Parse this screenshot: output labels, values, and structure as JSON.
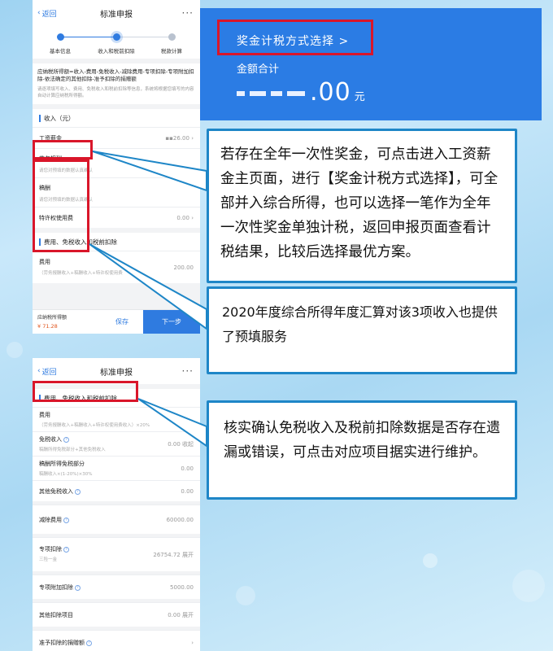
{
  "phone_top": {
    "nav": {
      "back": "返回",
      "title": "标准申报",
      "more": "···"
    },
    "steps": [
      "基本信息",
      "收入和税前扣除",
      "税款计算"
    ],
    "formula": "应纳税所得额=收入-费用-免税收入-减除费用-专项扣除-专项附加扣除-依法确定的其他扣除-准予扣除的捐赠额",
    "formula_desc": "请逐项填写收入、费用、免税收入和税前扣除等信息，系统将根据您填写的内容自动计算应纳税所得额。",
    "income_section": "收入（元）",
    "rows": [
      {
        "label": "工资薪金",
        "value": "26.00"
      },
      {
        "label": "劳务报酬",
        "sub": "请您对预填的数据认真确认"
      },
      {
        "label": "稿酬",
        "sub": "请您对预填的数据认真确认"
      },
      {
        "label": "特许权使用费",
        "value": "0.00"
      }
    ],
    "expense_section": "费用、免税收入和税前扣除",
    "expense_row": {
      "label": "费用",
      "sub": "（劳务报酬收入+稿酬收入+特许权使用费",
      "value": "200.00"
    },
    "footer": {
      "tax_label": "应纳税所得额",
      "tax_amount": "¥ 71.28",
      "save": "保存",
      "next": "下一步"
    }
  },
  "phone_bottom": {
    "nav": {
      "back": "返回",
      "title": "标准申报",
      "more": "···"
    },
    "section": "费用、免税收入和税前扣除",
    "rows": [
      {
        "label": "费用",
        "sub": "（劳务报酬收入+稿酬收入+特许权使用费收入）×20%",
        "value": ""
      },
      {
        "label": "免税收入",
        "sub": "稿酬所得免税部分+其他免税收入",
        "value": "0.00 收起",
        "help": true
      },
      {
        "label": "稿酬所得免税部分",
        "sub": "稿酬收入×(1-20%)×30%",
        "value": "0.00"
      },
      {
        "label": "其他免税收入",
        "value": "0.00",
        "help": true
      },
      {
        "label": "减除费用",
        "value": "60000.00",
        "help": true
      },
      {
        "label": "专项扣除",
        "sub": "三险一金",
        "value": "26754.72 展开",
        "help": true
      },
      {
        "label": "专项附加扣除",
        "value": "5000.00",
        "help": true
      },
      {
        "label": "其他扣除项目",
        "value": "0.00 展开"
      },
      {
        "label": "准予扣除的捐赠额",
        "value": "",
        "help": true
      }
    ]
  },
  "bonus_panel": {
    "select_label": "奖金计税方式选择 >",
    "sum_label": "金额合计",
    "amount_suffix": ".00",
    "currency": "元"
  },
  "callouts": {
    "c1": "若存在全年一次性奖金，可点击进入工资薪金主页面，进行【奖金计税方式选择】，可全部并入综合所得，也可以选择一笔作为全年一次性奖金单独计税，返回申报页面查看计税结果，比较后选择最优方案。",
    "c2": "2020年度综合所得年度汇算对该3项收入也提供了预填服务",
    "c3": "核实确认免税收入及税前扣除数据是否存在遗漏或错误，可点击对应项目据实进行维护。"
  },
  "colors": {
    "accent": "#2f7be0",
    "highlight": "#d9162a",
    "callout_border": "#1e86c7",
    "panel": "#2b7ce4"
  }
}
